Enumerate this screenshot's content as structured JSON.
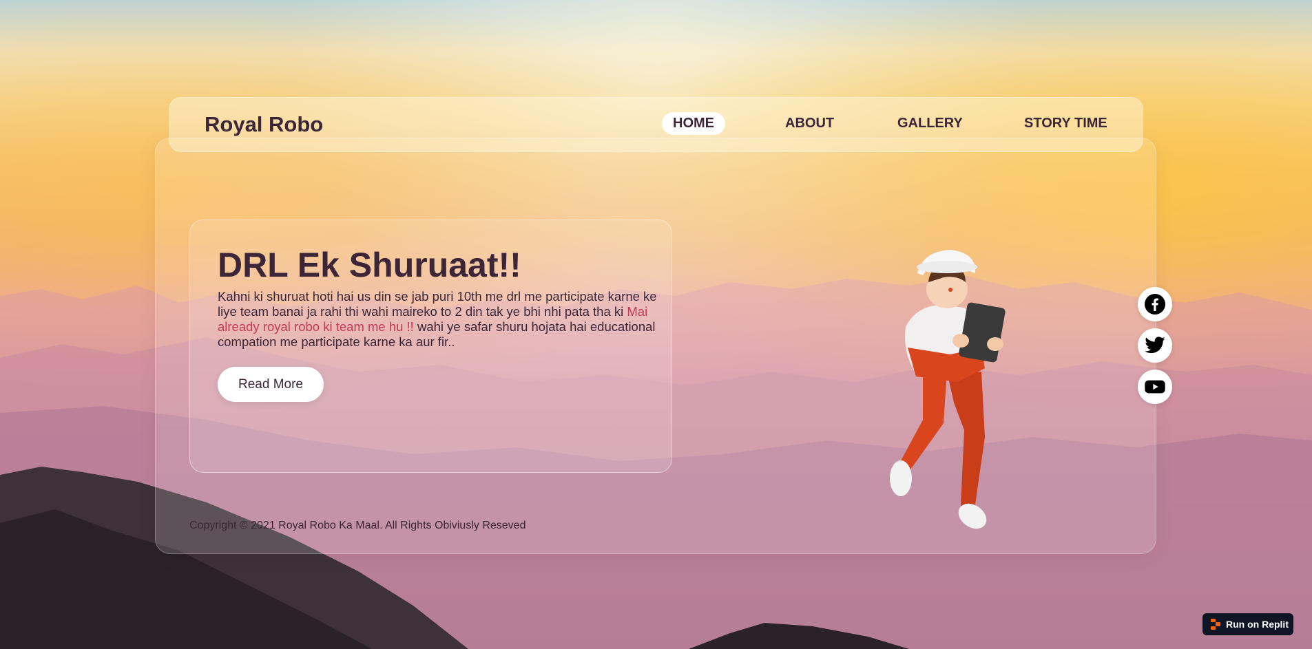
{
  "navbar": {
    "brand": "Royal Robo",
    "items": [
      {
        "label": "HOME",
        "active": true
      },
      {
        "label": "ABOUT",
        "active": false
      },
      {
        "label": "GALLERY",
        "active": false
      },
      {
        "label": "STORY TIME",
        "active": false
      }
    ]
  },
  "hero": {
    "title": "DRL Ek Shuruaat!!",
    "text_before": "Kahni ki shuruat hoti hai us din se jab puri 10th me drl me participate karne ke liye team banai ja rahi thi wahi maireko to 2 din tak ye bhi nhi pata tha ki ",
    "text_highlight": "Mai already royal robo ki team me hu !!",
    "text_after": " wahi ye safar shuru hojata hai educational compation me participate karne ka aur fir..",
    "button_label": "Read More"
  },
  "footer": {
    "copyright": "Copyright © 2021 Royal Robo Ka Maal. All Rights Obiviusly Reseved"
  },
  "social": [
    {
      "icon": "facebook-icon"
    },
    {
      "icon": "twitter-icon"
    },
    {
      "icon": "youtube-icon"
    }
  ],
  "replit_badge": {
    "label": "Run on Replit"
  },
  "colors": {
    "text_dark": "#3b2537",
    "highlight": "#c23a5a",
    "badge_bg": "#0e1525"
  }
}
